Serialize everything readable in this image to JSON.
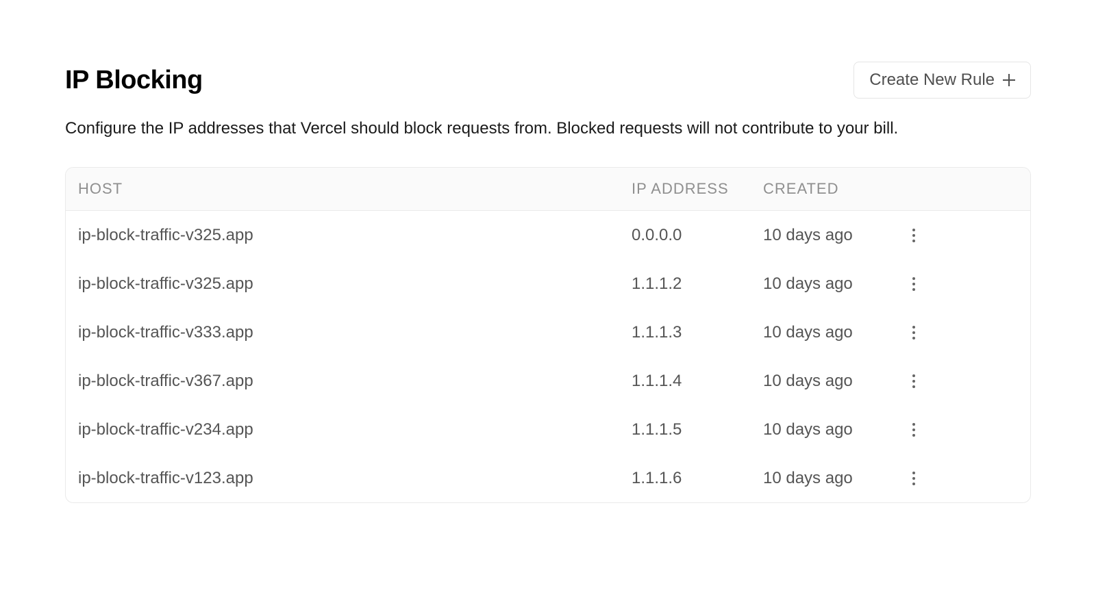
{
  "header": {
    "title": "IP Blocking",
    "create_button_label": "Create New Rule"
  },
  "description": "Configure the IP addresses that Vercel should block requests from. Blocked requests will not contribute to your bill.",
  "table": {
    "columns": {
      "host": "HOST",
      "ip": "IP ADDRESS",
      "created": "CREATED"
    },
    "rows": [
      {
        "host": "ip-block-traffic-v325.app",
        "ip": "0.0.0.0",
        "created": "10 days ago"
      },
      {
        "host": "ip-block-traffic-v325.app",
        "ip": "1.1.1.2",
        "created": "10 days ago"
      },
      {
        "host": "ip-block-traffic-v333.app",
        "ip": "1.1.1.3",
        "created": "10 days ago"
      },
      {
        "host": "ip-block-traffic-v367.app",
        "ip": "1.1.1.4",
        "created": "10 days ago"
      },
      {
        "host": "ip-block-traffic-v234.app",
        "ip": "1.1.1.5",
        "created": "10 days ago"
      },
      {
        "host": "ip-block-traffic-v123.app",
        "ip": "1.1.1.6",
        "created": "10 days ago"
      }
    ]
  }
}
